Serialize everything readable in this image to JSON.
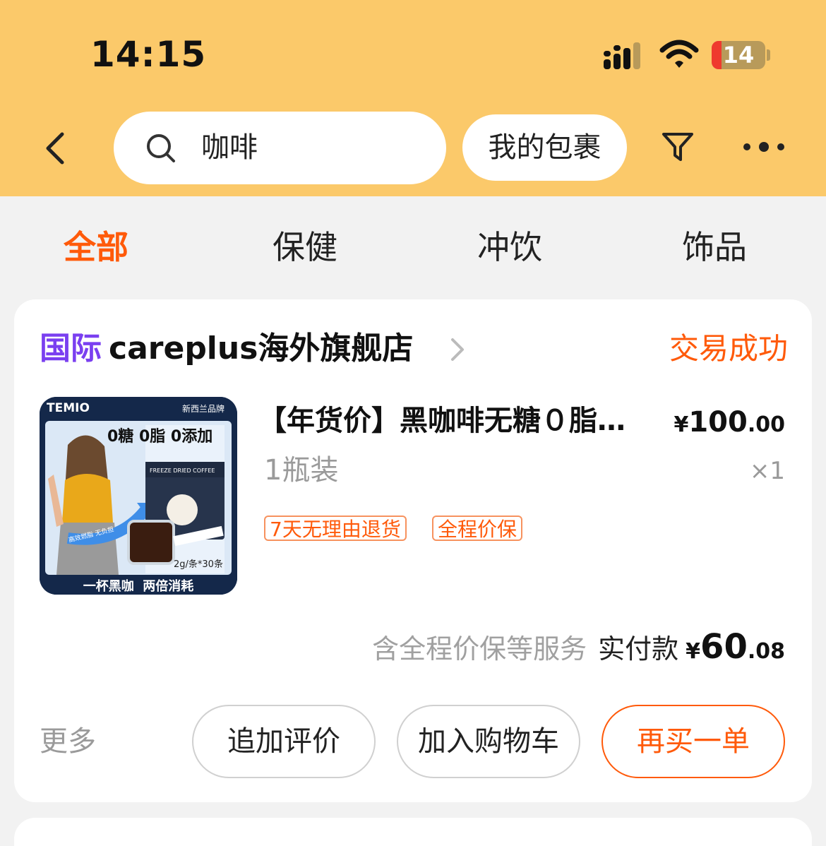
{
  "status_bar": {
    "time": "14:15",
    "battery": "14"
  },
  "search": {
    "query": "咖啡",
    "package_button": "我的包裹"
  },
  "tabs": [
    {
      "label": "全部",
      "active": true
    },
    {
      "label": "保健",
      "active": false
    },
    {
      "label": "冲饮",
      "active": false
    },
    {
      "label": "饰品",
      "active": false
    }
  ],
  "order": {
    "shop_badge": "国际",
    "shop_name": "careplus海外旗舰店",
    "status": "交易成功",
    "product": {
      "title": "【年货价】黑咖啡无糖０脂…",
      "price_symbol": "¥",
      "price_int": "100",
      "price_dec": ".00",
      "spec": "1瓶装",
      "quantity": "×1",
      "tags": [
        "7天无理由退货",
        "全程价保"
      ],
      "image": {
        "brand": "TEMIO",
        "origin": "新西兰品牌",
        "headline": "0糖 0脂 0添加",
        "box_label": "FREEZE DRIED COFFEE",
        "pack_size": "2g/条*30条",
        "ribbon": "高效燃脂 无负担",
        "slogan": "一杯黑咖  两倍消耗"
      }
    },
    "payment": {
      "note": "含全程价保等服务",
      "label": "实付款",
      "symbol": "¥",
      "int": "60",
      "dec": ".08"
    },
    "actions": {
      "more": "更多",
      "review": "追加评价",
      "add_cart": "加入购物车",
      "rebuy": "再买一单"
    }
  },
  "colors": {
    "header_bg": "#fbc96a",
    "accent": "#ff5a0a",
    "intl_purple": "#7a3ff0"
  }
}
